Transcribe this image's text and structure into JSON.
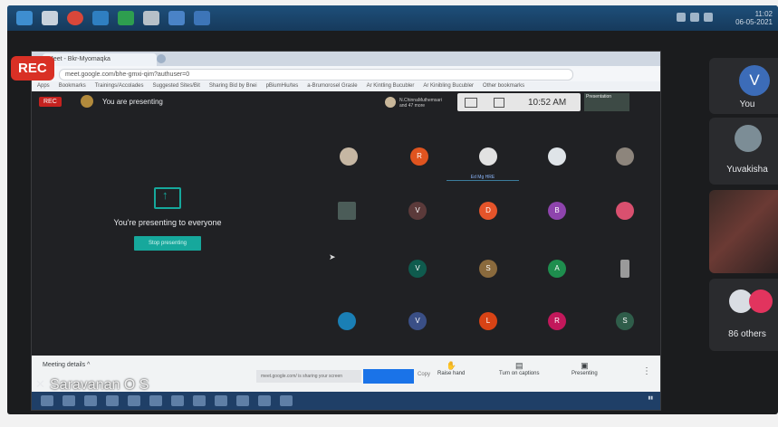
{
  "recording": {
    "badge": "REC",
    "inner_badge": "REC"
  },
  "browser": {
    "tab_title": "Meet - Bkr-Myomaqka",
    "address": "meet.google.com/bhe-gmxi-qim?authuser=0",
    "bookmarks": [
      "Apps",
      "Bookmarks",
      "Trainings/Accolades",
      "Suggested Sites/Bit",
      "Sharing Bid by Bnei",
      "pBiumHiu/tes",
      "a-Brumorosel Grasle",
      "Ar Kintling Bucubler",
      "Ar Kinibling Bucubler",
      "Other bookmarks"
    ]
  },
  "meet": {
    "presenting_status": "You are presenting",
    "pinned_user": "N.ChinnaMuthemsari",
    "pinned_user_sub": "and 47 more",
    "time": "10:52 AM",
    "presentation_thumb": "Presentation",
    "presenting_message": "You're presenting to everyone",
    "stop_button": "Stop presenting",
    "tile_label": "Ed Mg HRE",
    "participants": [
      "R",
      "V",
      "D",
      "B",
      "V",
      "S",
      "A",
      "V",
      "L",
      "R",
      "S"
    ],
    "bottom_bar": {
      "meeting_details": "Meeting details",
      "input_placeholder": "meet.google.com/ is sharing your screen",
      "copy_label": "Copy",
      "raise_hand": "Raise hand",
      "captions": "Turn on captions",
      "present": "Presenting"
    },
    "presenter_name": "Saravanan O S"
  },
  "host_clock": {
    "time": "11:02",
    "date": "06-05-2021"
  },
  "side_panel": {
    "you_initial": "V",
    "you_label": "You",
    "second_name": "Yuvakisha",
    "others_label": "86 others"
  },
  "colors": {
    "rec": "#d93025",
    "teal": "#16a89c",
    "meet_dark": "#202124"
  }
}
